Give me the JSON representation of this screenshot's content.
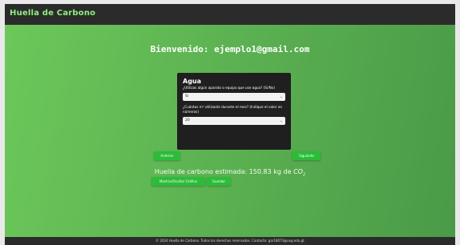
{
  "brand": "Huella de Carbono",
  "welcome": "Bienvenido: ejemplo1@gmail.com",
  "card": {
    "title": "Agua",
    "q1": "¿Utilizas algún aparato o equipo que use agua? (Si/No)",
    "q1_value": "Si",
    "q2": "¿Cuántos m³ utilizaste durante el mes? (Indique el valor en números)",
    "q2_value": "20"
  },
  "buttons": {
    "prev": "Anterior",
    "next": "Siguiente",
    "chart": "Mostrar/Ocultar Gráfico",
    "save": "Guardar"
  },
  "estimate": {
    "text": "Huella de carbono estimada: 150.83 kg de ",
    "unit": "CO",
    "unit_sub": "2"
  },
  "footer": "© 2024 Huella de Carbono. Todos los derechos reservados. Contacto: gar18073@uvg.edu.gt",
  "colors": {
    "accent": "#2cbc3a",
    "brand": "#8ff07f",
    "dark": "#1f1f1f"
  }
}
